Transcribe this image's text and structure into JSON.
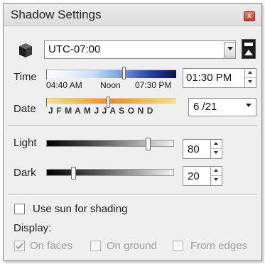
{
  "window": {
    "title": "Shadow Settings",
    "close_glyph": "x"
  },
  "timezone": {
    "icon": "cube-icon",
    "value": "UTC-07:00",
    "toggle_icon": "shadow-toggle-icon"
  },
  "time": {
    "label": "Time",
    "start_label": "04:40 AM",
    "noon_label": "Noon",
    "end_label": "07:30 PM",
    "value": "01:30 PM",
    "slider_position": 0.6
  },
  "date": {
    "label": "Date",
    "months": "J F M A M J J A S O N D",
    "value": "6 /21",
    "slider_position": 0.47
  },
  "light": {
    "label": "Light",
    "value": "80"
  },
  "dark": {
    "label": "Dark",
    "value": "20"
  },
  "use_sun": {
    "label": "Use sun for shading",
    "checked": false
  },
  "display": {
    "label": "Display:",
    "options": [
      {
        "label": "On faces",
        "checked": true,
        "enabled": false
      },
      {
        "label": "On ground",
        "checked": false,
        "enabled": false
      },
      {
        "label": "From edges",
        "checked": false,
        "enabled": false
      }
    ]
  }
}
